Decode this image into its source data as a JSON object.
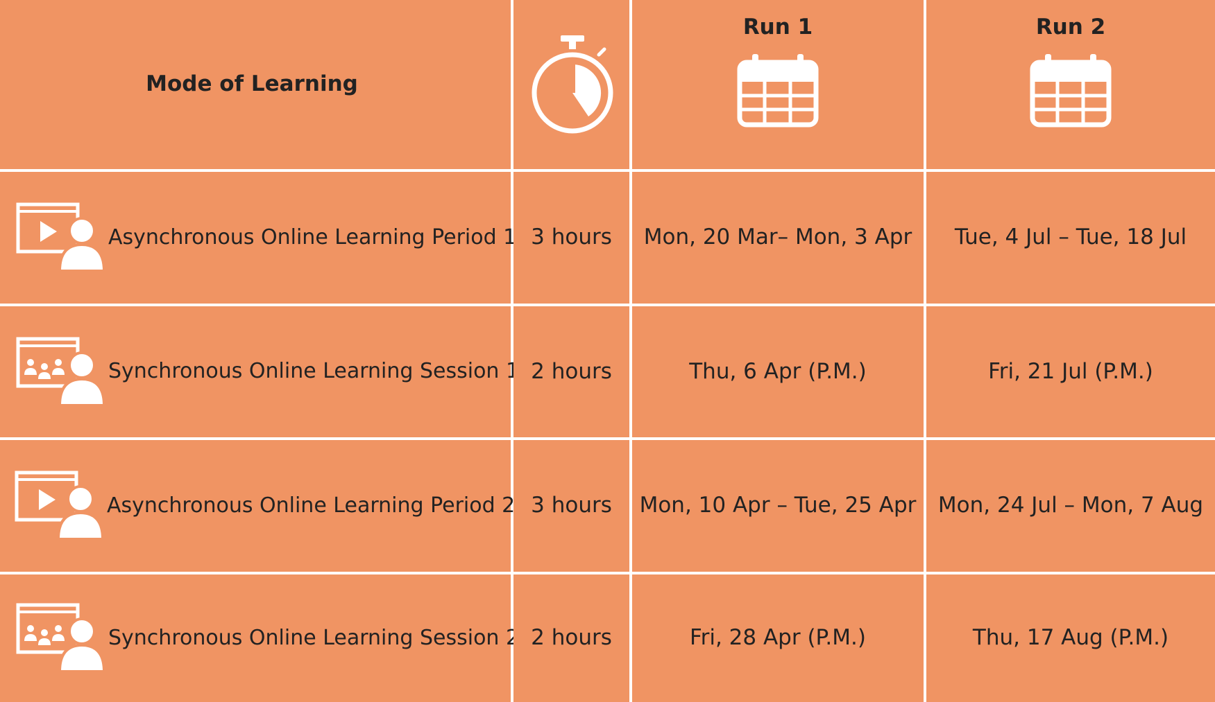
{
  "header": {
    "mode_title": "Mode of Learning",
    "duration_icon": "stopwatch-icon",
    "runs": [
      {
        "label": "Run 1",
        "icon": "calendar-icon"
      },
      {
        "label": "Run 2",
        "icon": "calendar-icon"
      }
    ]
  },
  "rows": [
    {
      "mode": "Asynchronous Online Learning Period 1",
      "icon": "video-learning-icon",
      "duration": "3 hours",
      "run1": "Mon, 20 Mar– Mon, 3 Apr",
      "run2": "Tue, 4 Jul – Tue, 18 Jul"
    },
    {
      "mode": "Synchronous Online Learning Session 1",
      "icon": "virtual-class-icon",
      "duration": "2 hours",
      "run1": "Thu, 6 Apr (P.M.)",
      "run2": "Fri, 21 Jul (P.M.)"
    },
    {
      "mode": "Asynchronous Online Learning Period 2",
      "icon": "video-learning-icon",
      "duration": "3 hours",
      "run1": "Mon, 10 Apr – Tue, 25 Apr",
      "run2": "Mon, 24 Jul – Mon, 7 Aug"
    },
    {
      "mode": "Synchronous Online Learning Session 2",
      "icon": "virtual-class-icon",
      "duration": "2 hours",
      "run1": "Fri, 28 Apr (P.M.)",
      "run2": "Thu, 17 Aug (P.M.)"
    }
  ],
  "colors": {
    "cell_background": "#f09463",
    "grid_lines": "#ffffff",
    "text": "#222222",
    "icon": "#ffffff"
  }
}
